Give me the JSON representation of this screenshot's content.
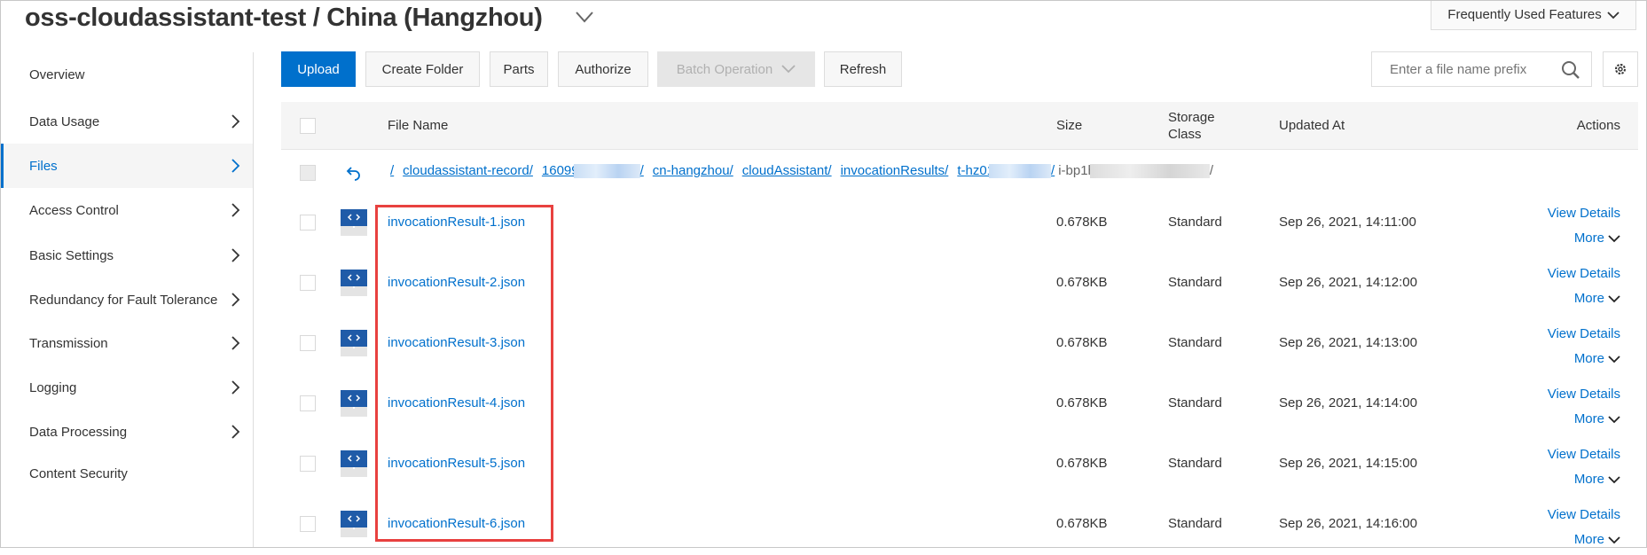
{
  "header": {
    "title": "oss-cloudassistant-test / China (Hangzhou)",
    "frequently_used": "Frequently Used Features"
  },
  "sidebar": {
    "items": [
      {
        "label": "Overview",
        "chevron": false
      },
      {
        "label": "Data Usage",
        "chevron": true
      },
      {
        "label": "Files",
        "chevron": true,
        "active": true
      },
      {
        "label": "Access Control",
        "chevron": true
      },
      {
        "label": "Basic Settings",
        "chevron": true
      },
      {
        "label": "Redundancy for Fault Tolerance",
        "chevron": true
      },
      {
        "label": "Transmission",
        "chevron": true
      },
      {
        "label": "Logging",
        "chevron": true
      },
      {
        "label": "Data Processing",
        "chevron": true
      },
      {
        "label": "Content Security",
        "chevron": false
      }
    ]
  },
  "toolbar": {
    "upload": "Upload",
    "create_folder": "Create Folder",
    "parts": "Parts",
    "authorize": "Authorize",
    "batch_operation": "Batch Operation",
    "refresh": "Refresh",
    "search_placeholder": "Enter a file name prefix"
  },
  "table": {
    "headers": {
      "file_name": "File Name",
      "size": "Size",
      "storage_class_1": "Storage",
      "storage_class_2": "Class",
      "updated_at": "Updated At",
      "actions": "Actions"
    },
    "breadcrumb": [
      "/",
      "cloudassistant-record/",
      "16099",
      "/",
      "cn-hangzhou/",
      "cloudAssistant/",
      "invocationResults/",
      "t-hz01",
      "/",
      "i-bp1h",
      "/"
    ],
    "rows": [
      {
        "name": "invocationResult-1.json",
        "size": "0.678KB",
        "storage": "Standard",
        "updated": "Sep 26, 2021, 14:11:00",
        "view": "View Details",
        "more": "More"
      },
      {
        "name": "invocationResult-2.json",
        "size": "0.678KB",
        "storage": "Standard",
        "updated": "Sep 26, 2021, 14:12:00",
        "view": "View Details",
        "more": "More"
      },
      {
        "name": "invocationResult-3.json",
        "size": "0.678KB",
        "storage": "Standard",
        "updated": "Sep 26, 2021, 14:13:00",
        "view": "View Details",
        "more": "More"
      },
      {
        "name": "invocationResult-4.json",
        "size": "0.678KB",
        "storage": "Standard",
        "updated": "Sep 26, 2021, 14:14:00",
        "view": "View Details",
        "more": "More"
      },
      {
        "name": "invocationResult-5.json",
        "size": "0.678KB",
        "storage": "Standard",
        "updated": "Sep 26, 2021, 14:15:00",
        "view": "View Details",
        "more": "More"
      },
      {
        "name": "invocationResult-6.json",
        "size": "0.678KB",
        "storage": "Standard",
        "updated": "Sep 26, 2021, 14:16:00",
        "view": "View Details",
        "more": "More"
      }
    ]
  },
  "colors": {
    "primary": "#0070cc",
    "highlight": "#e8413f"
  }
}
